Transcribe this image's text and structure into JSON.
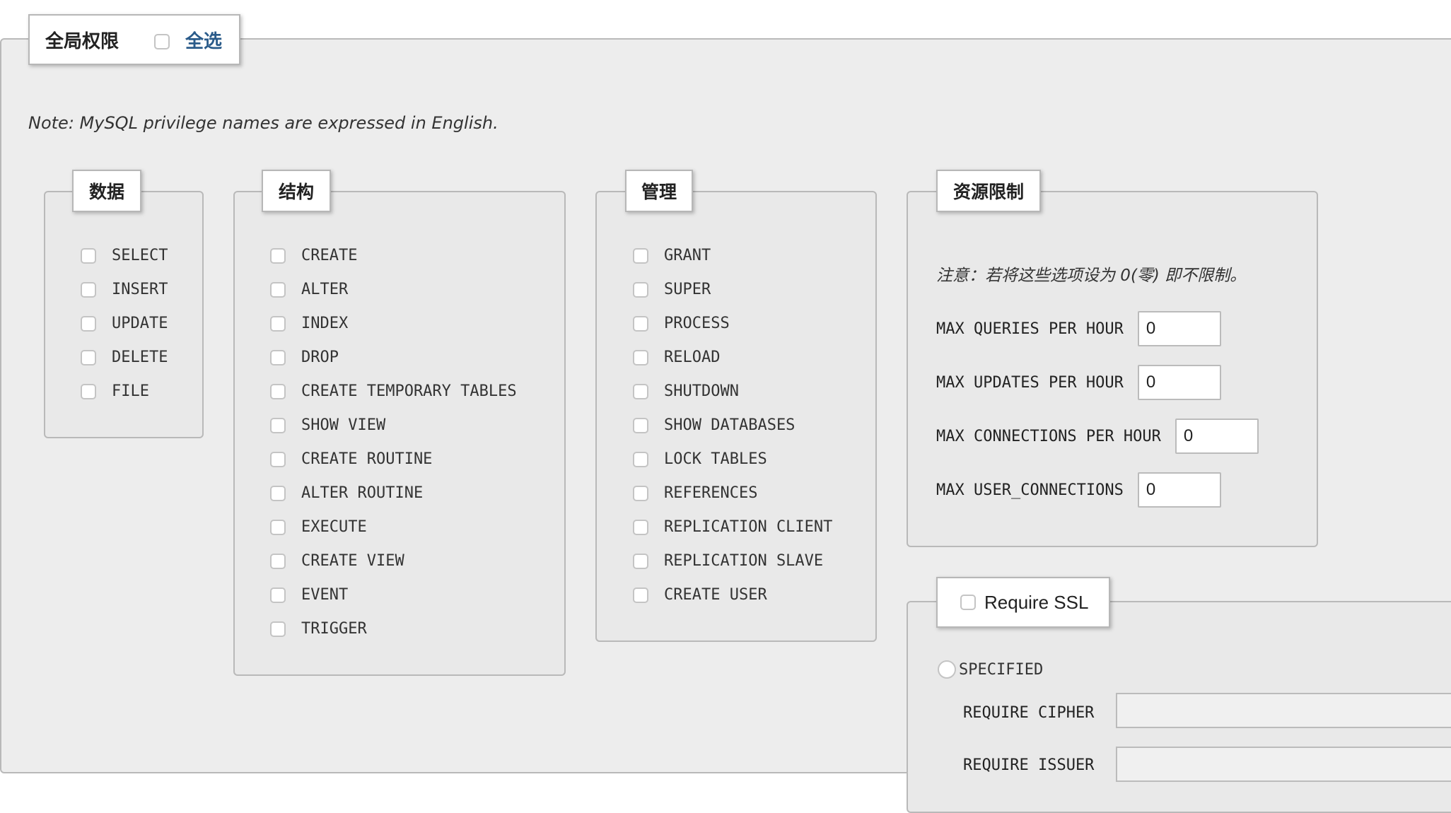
{
  "global": {
    "title": "全局权限",
    "select_all": "全选"
  },
  "note": "Note: MySQL privilege names are expressed in English.",
  "groups": {
    "data": {
      "title": "数据",
      "items": [
        "SELECT",
        "INSERT",
        "UPDATE",
        "DELETE",
        "FILE"
      ]
    },
    "structure": {
      "title": "结构",
      "items": [
        "CREATE",
        "ALTER",
        "INDEX",
        "DROP",
        "CREATE TEMPORARY TABLES",
        "SHOW VIEW",
        "CREATE ROUTINE",
        "ALTER ROUTINE",
        "EXECUTE",
        "CREATE VIEW",
        "EVENT",
        "TRIGGER"
      ]
    },
    "admin": {
      "title": "管理",
      "items": [
        "GRANT",
        "SUPER",
        "PROCESS",
        "RELOAD",
        "SHUTDOWN",
        "SHOW DATABASES",
        "LOCK TABLES",
        "REFERENCES",
        "REPLICATION CLIENT",
        "REPLICATION SLAVE",
        "CREATE USER"
      ]
    }
  },
  "resources": {
    "title": "资源限制",
    "note": "注意：若将这些选项设为 0(零) 即不限制。",
    "rows": [
      {
        "label": "MAX QUERIES PER HOUR",
        "value": "0"
      },
      {
        "label": "MAX UPDATES PER HOUR",
        "value": "0"
      },
      {
        "label": "MAX CONNECTIONS PER HOUR",
        "value": "0"
      },
      {
        "label": "MAX USER_CONNECTIONS",
        "value": "0"
      }
    ]
  },
  "ssl": {
    "title": "Require SSL",
    "specified": "SPECIFIED",
    "require_cipher": "REQUIRE CIPHER",
    "require_issuer": "REQUIRE ISSUER"
  }
}
